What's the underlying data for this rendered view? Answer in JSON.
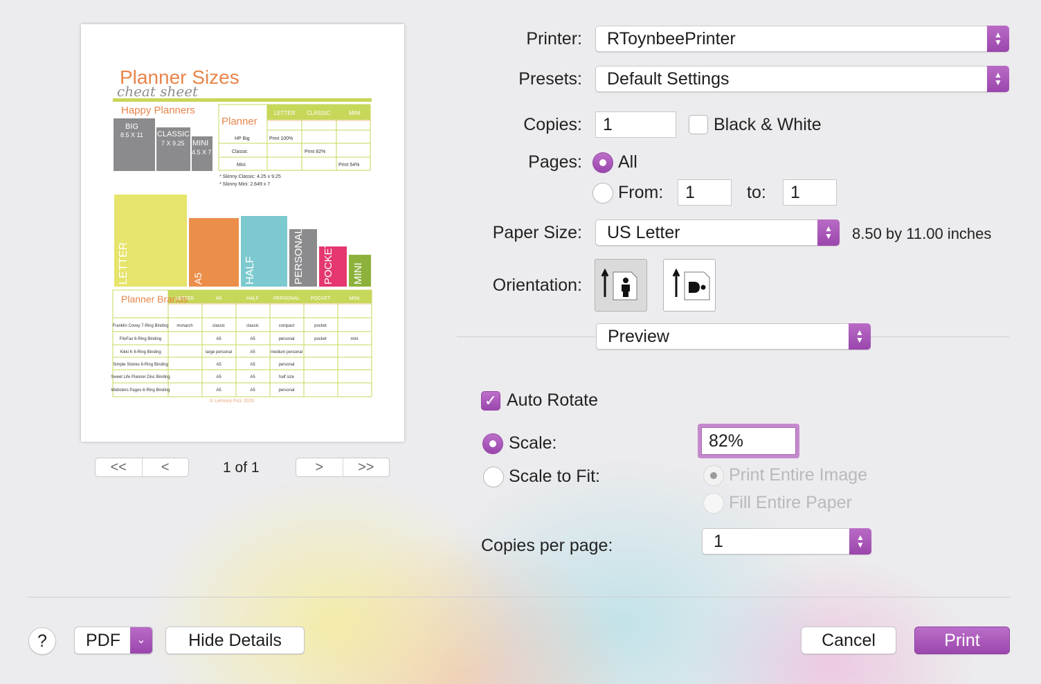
{
  "printer": {
    "label": "Printer:",
    "value": "RToynbeePrinter"
  },
  "presets": {
    "label": "Presets:",
    "value": "Default Settings"
  },
  "copies": {
    "label": "Copies:",
    "value": "1",
    "bw_label": "Black & White",
    "bw_checked": false
  },
  "pages": {
    "label": "Pages:",
    "all_label": "All",
    "from_label": "From:",
    "from_value": "1",
    "to_label": "to:",
    "to_value": "1",
    "selected": "all"
  },
  "paper_size": {
    "label": "Paper Size:",
    "value": "US Letter",
    "dimensions": "8.50 by 11.00 inches"
  },
  "orientation": {
    "label": "Orientation:",
    "selected": "portrait"
  },
  "app_menu": {
    "value": "Preview"
  },
  "auto_rotate": {
    "label": "Auto Rotate",
    "checked": true
  },
  "scale": {
    "label": "Scale:",
    "value": "82%",
    "selected": true
  },
  "scale_to_fit": {
    "label": "Scale to Fit:",
    "print_entire_label": "Print Entire Image",
    "fill_entire_label": "Fill Entire Paper"
  },
  "copies_per_page": {
    "label": "Copies per page:",
    "value": "1"
  },
  "preview_nav": {
    "first": "<<",
    "prev": "<",
    "page_text": "1 of 1",
    "next": ">",
    "last": ">>"
  },
  "footer": {
    "help": "?",
    "pdf": "PDF",
    "hide_details": "Hide Details",
    "cancel": "Cancel",
    "print": "Print"
  },
  "colors": {
    "accent": "#a552b6",
    "accent_dark": "#8f3fa2"
  },
  "preview_doc": {
    "title": "Planner Sizes",
    "subtitle": "cheat sheet",
    "happy": "Happy Planners",
    "hp_big": "BIG",
    "hp_big_size": "8.5 X 11",
    "hp_classic": "CLASSIC",
    "hp_classic_size": "7 X 9.25",
    "hp_mini": "MINI",
    "hp_mini_size": "4.5 X 7",
    "planner_head": "Planner",
    "cols1": [
      "LETTER",
      "CLASSIC",
      "MINI"
    ],
    "rows1": [
      {
        "name": "HP Big",
        "c1": "Print 100%",
        "c2": "",
        "c3": ""
      },
      {
        "name": "Classic",
        "c1": "",
        "c2": "Print 82%",
        "c3": ""
      },
      {
        "name": "Mini",
        "c1": "",
        "c2": "",
        "c3": "Print 54%"
      }
    ],
    "note1": "* Skinny Classic: 4.25 x 9.25",
    "note2": "* Skinny Mini: 2.649 x 7",
    "bars": [
      "LETTER",
      "A5",
      "HALF",
      "PERSONAL",
      "POCKET",
      "MINI"
    ],
    "brands_head": "Planner Brands",
    "cols2": [
      "LETTER",
      "A5",
      "HALF",
      "PERSONAL",
      "POCKET",
      "MINI"
    ],
    "rows2": [
      {
        "name": "Franklin Covey 7-Ring Binding",
        "v": [
          "monarch",
          "classic",
          "classic",
          "compact",
          "pocket",
          ""
        ]
      },
      {
        "name": "FiloFax 6-Ring Binding",
        "v": [
          "",
          "A5",
          "A5",
          "personal",
          "pocket",
          "mini"
        ]
      },
      {
        "name": "Kikki K 6-Ring Binding",
        "v": [
          "",
          "large personal",
          "A5",
          "medium personal",
          "",
          ""
        ]
      },
      {
        "name": "Simple Stories 6-Ring Binding",
        "v": [
          "",
          "A5",
          "A5",
          "personal",
          "",
          ""
        ]
      },
      {
        "name": "Sweet Life Planner Disc Binding",
        "v": [
          "",
          "A5",
          "A5",
          "half size",
          "",
          ""
        ]
      },
      {
        "name": "Websters Pages 6-Ring Binding",
        "v": [
          "",
          "A5",
          "A5",
          "personal",
          "",
          ""
        ]
      }
    ],
    "copyright": "© Lemony Fizz 2020"
  }
}
